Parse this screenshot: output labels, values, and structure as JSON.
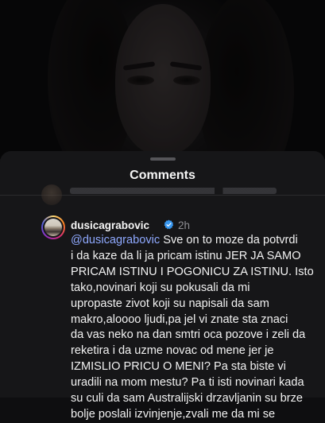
{
  "sheet": {
    "title": "Comments"
  },
  "comment": {
    "username": "dusicagrabovic",
    "time": "2h",
    "verified_icon": "verified-badge-icon",
    "mention": "@dusicagrabovic",
    "lines": [
      " Sve on to moze da potvrdi",
      "i da kaze da li ja pricam istinu JER JA SAMO",
      "PRICAM ISTINU I POGONICU ZA ISTINU. Isto",
      "tako,novinari koji su pokusali da mi",
      "upropaste zivot koji su napisali da sam",
      "makro,aloooo ljudi,pa jel vi znate sta znaci",
      "da vas neko na dan smtri oca pozove i zeli da",
      "reketira i da uzme novac od mene jer je",
      "IZMISLIO PRICU O MENI? Pa sta biste vi",
      "uradili na mom mestu? Pa ti isti novinari kada",
      "su culi da sam Australijski drzavljanin su brze",
      "bolje poslali izvinjenje,zvali me da mi se"
    ]
  },
  "colors": {
    "sheet_bg": "#161618",
    "mention": "#8fa9ff",
    "verified": "#3897f0"
  }
}
